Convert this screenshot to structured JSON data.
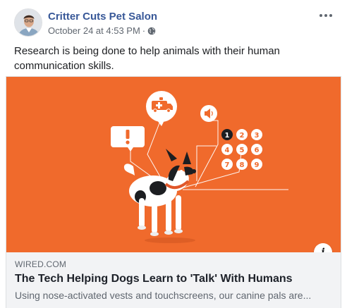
{
  "post": {
    "author": "Critter Cuts Pet Salon",
    "timestamp": "October 24 at 4:53 PM",
    "separator": "·",
    "privacy_icon": "globe-icon",
    "more_icon": "more-options-icon",
    "text": "Research is being done to help animals with their human communication skills."
  },
  "link": {
    "domain": "WIRED.COM",
    "title": "The Tech Helping Dogs Learn to 'Talk' With Humans",
    "description": "Using nose-activated vests and touchscreens, our canine pals are...",
    "info_label": "i"
  },
  "illustration": {
    "background_color": "#f06a2c",
    "bubbles": [
      "alert-icon",
      "ambulance-icon",
      "speaker-icon"
    ],
    "keypad": [
      "1",
      "2",
      "3",
      "4",
      "5",
      "6",
      "7",
      "8",
      "9"
    ],
    "keypad_active": "1"
  },
  "colors": {
    "author": "#385898",
    "meta": "#606770",
    "card_bg": "#f2f3f5"
  }
}
